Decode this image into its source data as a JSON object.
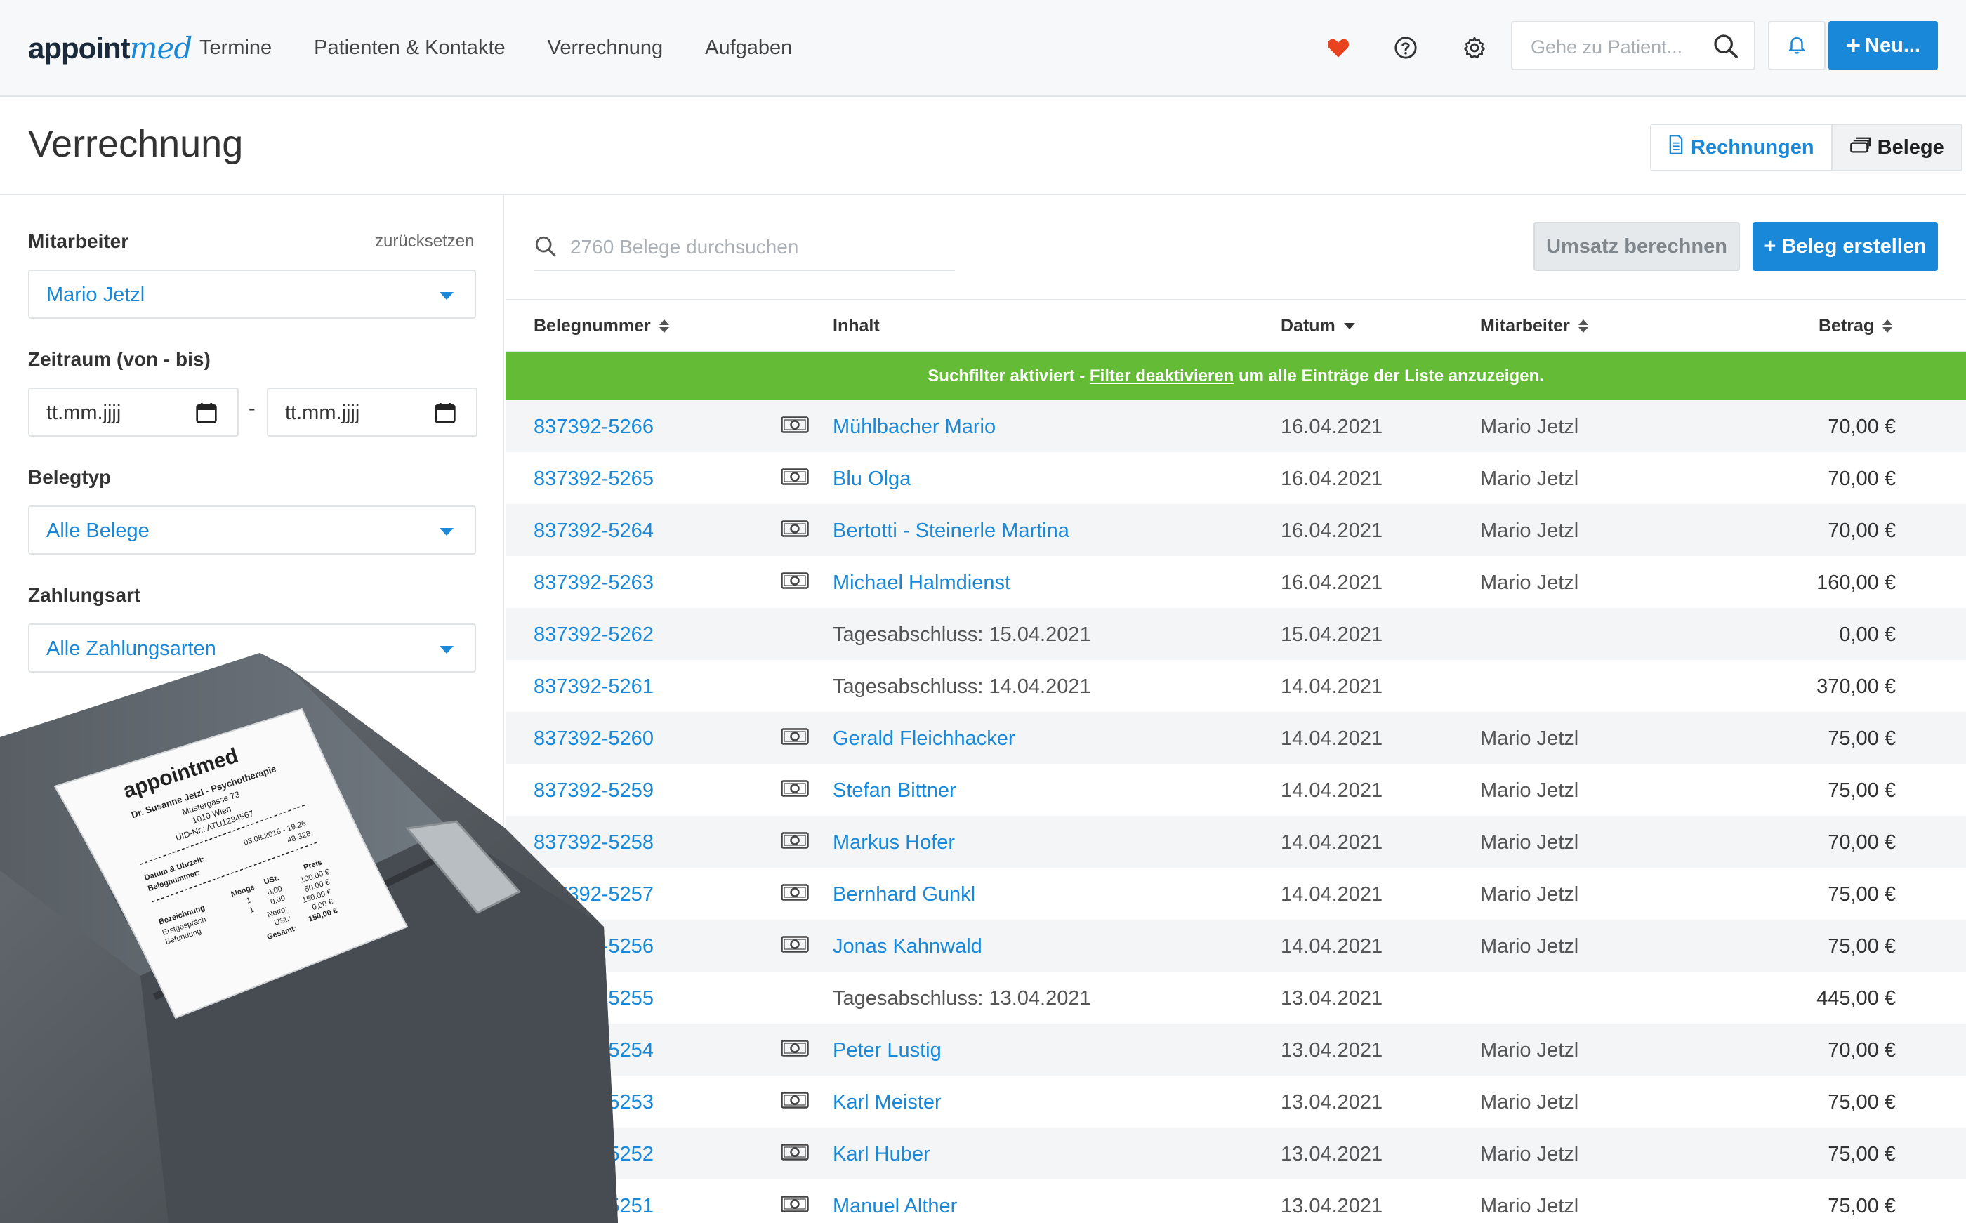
{
  "header": {
    "logo_main": "appoint",
    "logo_accent": "med",
    "nav": [
      "Termine",
      "Patienten & Kontakte",
      "Verrechnung",
      "Aufgaben"
    ],
    "search_placeholder": "Gehe zu Patient...",
    "new_button": "Neu..."
  },
  "page": {
    "title": "Verrechnung",
    "tab_rechnungen": "Rechnungen",
    "tab_belege": "Belege"
  },
  "filters": {
    "mitarbeiter_label": "Mitarbeiter",
    "reset": "zurücksetzen",
    "mitarbeiter_value": "Mario Jetzl",
    "zeitraum_label": "Zeitraum (von - bis)",
    "date_from": "tt.mm.jjjj",
    "date_sep": "-",
    "date_to": "tt.mm.jjjj",
    "belegtyp_label": "Belegtyp",
    "belegtyp_value": "Alle Belege",
    "zahlungsart_label": "Zahlungsart",
    "zahlungsart_value": "Alle Zahlungsarten"
  },
  "toolbar": {
    "search_placeholder": "2760 Belege durchsuchen",
    "umsatz_button": "Umsatz berechnen",
    "create_button": "+ Beleg erstellen"
  },
  "table": {
    "headers": {
      "belegnummer": "Belegnummer",
      "inhalt": "Inhalt",
      "datum": "Datum",
      "mitarbeiter": "Mitarbeiter",
      "betrag": "Betrag"
    },
    "banner_before": "Suchfilter aktiviert - ",
    "banner_link": "Filter deaktivieren",
    "banner_after": " um alle Einträge der Liste anzuzeigen.",
    "rows": [
      {
        "num": "837392-5266",
        "cash": true,
        "inhalt": "Mühlbacher Mario",
        "link": true,
        "datum": "16.04.2021",
        "mitarbeiter": "Mario Jetzl",
        "betrag": "70,00 €"
      },
      {
        "num": "837392-5265",
        "cash": true,
        "inhalt": "Blu Olga",
        "link": true,
        "datum": "16.04.2021",
        "mitarbeiter": "Mario Jetzl",
        "betrag": "70,00 €"
      },
      {
        "num": "837392-5264",
        "cash": true,
        "inhalt": "Bertotti - Steinerle Martina",
        "link": true,
        "datum": "16.04.2021",
        "mitarbeiter": "Mario Jetzl",
        "betrag": "70,00 €"
      },
      {
        "num": "837392-5263",
        "cash": true,
        "inhalt": "Michael Halmdienst",
        "link": true,
        "datum": "16.04.2021",
        "mitarbeiter": "Mario Jetzl",
        "betrag": "160,00 €"
      },
      {
        "num": "837392-5262",
        "cash": false,
        "inhalt": "Tagesabschluss: 15.04.2021",
        "link": false,
        "datum": "15.04.2021",
        "mitarbeiter": "",
        "betrag": "0,00 €"
      },
      {
        "num": "837392-5261",
        "cash": false,
        "inhalt": "Tagesabschluss: 14.04.2021",
        "link": false,
        "datum": "14.04.2021",
        "mitarbeiter": "",
        "betrag": "370,00 €"
      },
      {
        "num": "837392-5260",
        "cash": true,
        "inhalt": "Gerald Fleichhacker",
        "link": true,
        "datum": "14.04.2021",
        "mitarbeiter": "Mario Jetzl",
        "betrag": "75,00 €"
      },
      {
        "num": "837392-5259",
        "cash": true,
        "inhalt": "Stefan Bittner",
        "link": true,
        "datum": "14.04.2021",
        "mitarbeiter": "Mario Jetzl",
        "betrag": "75,00 €"
      },
      {
        "num": "837392-5258",
        "cash": true,
        "inhalt": "Markus Hofer",
        "link": true,
        "datum": "14.04.2021",
        "mitarbeiter": "Mario Jetzl",
        "betrag": "70,00 €"
      },
      {
        "num": "837392-5257",
        "cash": true,
        "inhalt": "Bernhard Gunkl",
        "link": true,
        "datum": "14.04.2021",
        "mitarbeiter": "Mario Jetzl",
        "betrag": "75,00 €"
      },
      {
        "num": "837392-5256",
        "cash": true,
        "inhalt": "Jonas Kahnwald",
        "link": true,
        "datum": "14.04.2021",
        "mitarbeiter": "Mario Jetzl",
        "betrag": "75,00 €"
      },
      {
        "num": "837392-5255",
        "cash": false,
        "inhalt": "Tagesabschluss: 13.04.2021",
        "link": false,
        "datum": "13.04.2021",
        "mitarbeiter": "",
        "betrag": "445,00 €"
      },
      {
        "num": "837392-5254",
        "cash": true,
        "inhalt": "Peter Lustig",
        "link": true,
        "datum": "13.04.2021",
        "mitarbeiter": "Mario Jetzl",
        "betrag": "70,00 €"
      },
      {
        "num": "837392-5253",
        "cash": true,
        "inhalt": "Karl Meister",
        "link": true,
        "datum": "13.04.2021",
        "mitarbeiter": "Mario Jetzl",
        "betrag": "75,00 €"
      },
      {
        "num": "837392-5252",
        "cash": true,
        "inhalt": "Karl Huber",
        "link": true,
        "datum": "13.04.2021",
        "mitarbeiter": "Mario Jetzl",
        "betrag": "75,00 €"
      },
      {
        "num": "837392-5251",
        "cash": true,
        "inhalt": "Manuel Alther",
        "link": true,
        "datum": "13.04.2021",
        "mitarbeiter": "Mario Jetzl",
        "betrag": "75,00 €"
      }
    ]
  },
  "receipt": {
    "brand": "appointmed",
    "practice": "Dr. Susanne Jetzl - Psychotherapie",
    "street": "Mustergasse 73",
    "city": "1010 Wien",
    "uid": "UID-Nr.: ATU1234567",
    "datum_label": "Datum & Uhrzeit:",
    "datum_value": "03.08.2016 - 19:26",
    "beleg_label": "Belegnummer:",
    "beleg_value": "48-328",
    "col_bezeichnung": "Bezeichnung",
    "col_menge": "Menge",
    "col_ust": "USt.",
    "col_preis": "Preis",
    "item1": "Erstgespräch",
    "item2": "Befundung",
    "netto_label": "Netto:",
    "ust_label": "USt.:",
    "gesamt_label": "Gesamt:",
    "price1": "100,00 €",
    "price2": "50,00 €",
    "netto_value": "150,00 €",
    "ust_value": "0,00 €",
    "gesamt_value": "150,00 €",
    "menge1": "1",
    "menge2": "1",
    "ust1": "0,00",
    "ust2": "0,00"
  },
  "colors": {
    "accent": "#1a88d8",
    "banner": "#64bb36",
    "heart": "#e8421e"
  }
}
